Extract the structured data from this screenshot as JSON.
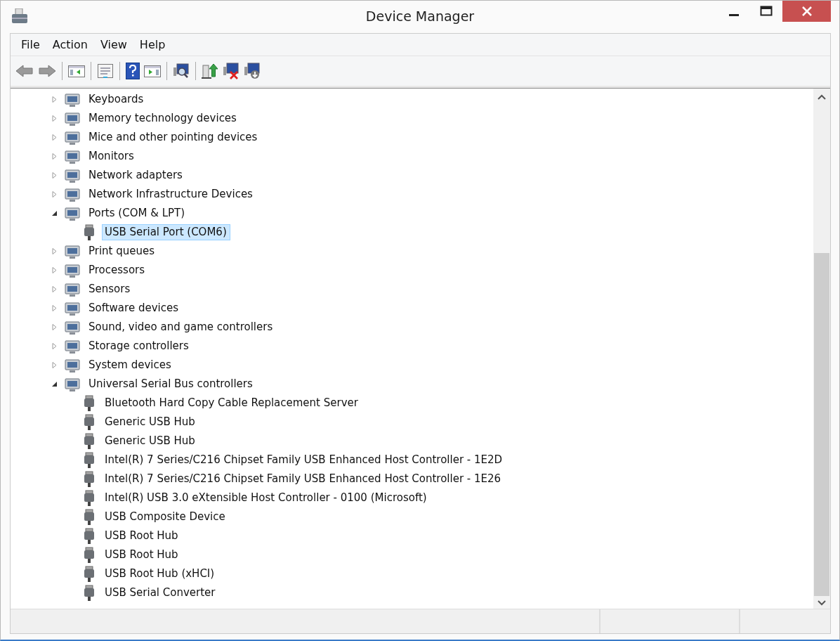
{
  "window": {
    "title": "Device Manager"
  },
  "menu": [
    "File",
    "Action",
    "View",
    "Help"
  ],
  "tree": [
    {
      "label": "Keyboards",
      "expanded": false,
      "selected": false
    },
    {
      "label": "Memory technology devices",
      "expanded": false,
      "selected": false
    },
    {
      "label": "Mice and other pointing devices",
      "expanded": false,
      "selected": false
    },
    {
      "label": "Monitors",
      "expanded": false,
      "selected": false
    },
    {
      "label": "Network adapters",
      "expanded": false,
      "selected": false
    },
    {
      "label": "Network Infrastructure Devices",
      "expanded": false,
      "selected": false
    },
    {
      "label": "Ports (COM & LPT)",
      "expanded": true,
      "selected": false,
      "children": [
        {
          "label": "USB Serial Port (COM6)",
          "selected": true
        }
      ]
    },
    {
      "label": "Print queues",
      "expanded": false,
      "selected": false
    },
    {
      "label": "Processors",
      "expanded": false,
      "selected": false
    },
    {
      "label": "Sensors",
      "expanded": false,
      "selected": false
    },
    {
      "label": "Software devices",
      "expanded": false,
      "selected": false
    },
    {
      "label": "Sound, video and game controllers",
      "expanded": false,
      "selected": false
    },
    {
      "label": "Storage controllers",
      "expanded": false,
      "selected": false
    },
    {
      "label": "System devices",
      "expanded": false,
      "selected": false
    },
    {
      "label": "Universal Serial Bus controllers",
      "expanded": true,
      "selected": false,
      "children": [
        {
          "label": "Bluetooth Hard Copy Cable Replacement Server",
          "selected": false
        },
        {
          "label": "Generic USB Hub",
          "selected": false
        },
        {
          "label": "Generic USB Hub",
          "selected": false
        },
        {
          "label": "Intel(R) 7 Series/C216 Chipset Family USB Enhanced Host Controller - 1E2D",
          "selected": false
        },
        {
          "label": "Intel(R) 7 Series/C216 Chipset Family USB Enhanced Host Controller - 1E26",
          "selected": false
        },
        {
          "label": "Intel(R) USB 3.0 eXtensible Host Controller - 0100 (Microsoft)",
          "selected": false
        },
        {
          "label": "USB Composite Device",
          "selected": false
        },
        {
          "label": "USB Root Hub",
          "selected": false
        },
        {
          "label": "USB Root Hub",
          "selected": false
        },
        {
          "label": "USB Root Hub (xHCI)",
          "selected": false
        },
        {
          "label": "USB Serial Converter",
          "selected": false
        }
      ]
    }
  ]
}
